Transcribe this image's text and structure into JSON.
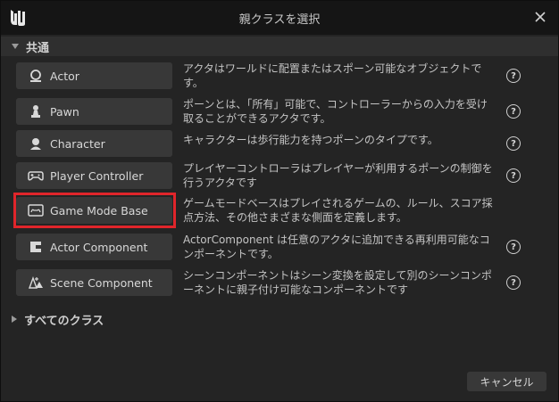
{
  "window": {
    "title": "親クラスを選択"
  },
  "sections": {
    "common_label": "共通",
    "all_label": "すべてのクラス"
  },
  "classes": [
    {
      "label": "Actor",
      "icon": "actor-icon",
      "description": "アクタはワールドに配置またはスポーン可能なオブジェクトです。"
    },
    {
      "label": "Pawn",
      "icon": "pawn-icon",
      "description": "ポーンとは、「所有」可能で、コントローラーからの入力を受け取ることができるアクタです。"
    },
    {
      "label": "Character",
      "icon": "character-icon",
      "description": "キャラクターは歩行能力を持つポーンのタイプです。"
    },
    {
      "label": "Player Controller",
      "icon": "gamepad-icon",
      "description": "プレイヤーコントローラはプレイヤーが利用するポーンの制御を行うアクタです"
    },
    {
      "label": "Game Mode Base",
      "icon": "game-mode-icon",
      "description": "ゲームモードベースはプレイされるゲームの、ルール、スコア採点方法、その他さまざまな側面を定義します。"
    },
    {
      "label": "Actor Component",
      "icon": "component-icon",
      "description": "ActorComponent は任意のアクタに追加できる再利用可能なコンポーネントです。"
    },
    {
      "label": "Scene Component",
      "icon": "scene-component-icon",
      "description": "シーンコンポーネントはシーン変換を設定して別のシーンコンポーネントに親子付け可能なコンポーネントです"
    }
  ],
  "help_glyph": "?",
  "footer": {
    "cancel_label": "キャンセル"
  },
  "colors": {
    "highlight": "#e0252b",
    "title_bg": "#151515",
    "panel_bg": "#242424",
    "button_bg": "#383838"
  }
}
